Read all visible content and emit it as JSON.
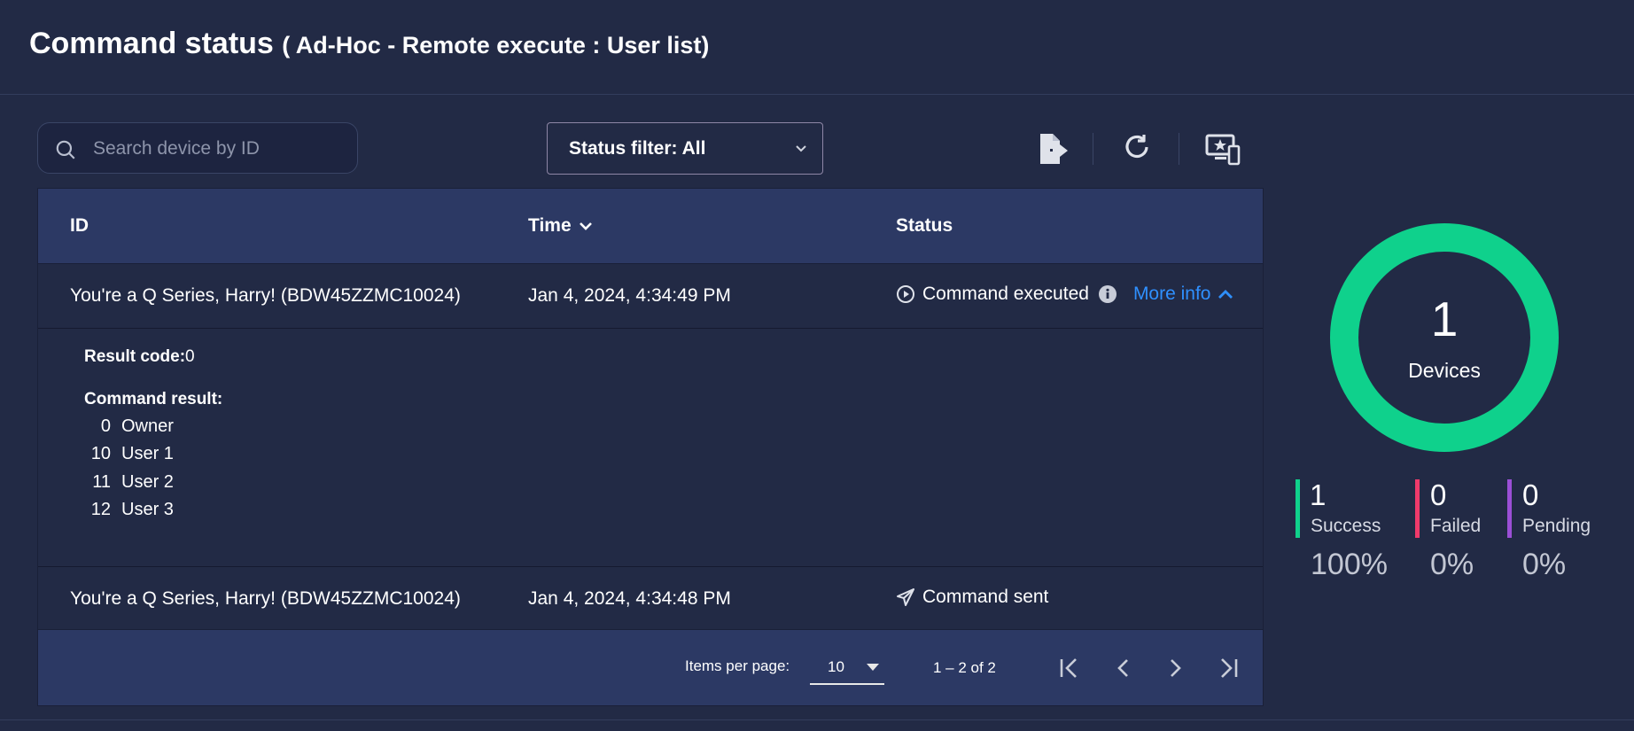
{
  "header": {
    "title": "Command status",
    "subtitle": "( Ad-Hoc - Remote execute : User list)"
  },
  "search": {
    "placeholder": "Search device by ID",
    "value": ""
  },
  "filter": {
    "label": "Status filter: All"
  },
  "toolbar": {
    "icons": [
      "export-icon",
      "refresh-icon",
      "device-star-icon"
    ]
  },
  "table": {
    "columns": {
      "id": "ID",
      "time": "Time",
      "status": "Status"
    },
    "sort": {
      "column": "Time",
      "direction": "desc"
    },
    "rows": [
      {
        "id": "You're a Q Series, Harry! (BDW45ZZMC10024)",
        "time": "Jan 4, 2024, 4:34:49 PM",
        "status": "Command executed",
        "more_info": "More info",
        "expanded": true,
        "details": {
          "result_code_label": "Result code:",
          "result_code": "0",
          "command_result_label": "Command result:",
          "users": [
            {
              "id": "0",
              "name": "Owner"
            },
            {
              "id": "10",
              "name": "User 1"
            },
            {
              "id": "11",
              "name": "User 2"
            },
            {
              "id": "12",
              "name": "User 3"
            }
          ]
        }
      },
      {
        "id": "You're a Q Series, Harry! (BDW45ZZMC10024)",
        "time": "Jan 4, 2024, 4:34:48 PM",
        "status": "Command sent"
      }
    ]
  },
  "pagination": {
    "items_per_page_label": "Items per page:",
    "items_per_page": "10",
    "range": "1 – 2 of 2"
  },
  "summary": {
    "total": "1",
    "total_label": "Devices",
    "success": {
      "count": "1",
      "label": "Success",
      "percent": "100%",
      "color": "#0fd18c"
    },
    "failed": {
      "count": "0",
      "label": "Failed",
      "percent": "0%",
      "color": "#ef3a6b"
    },
    "pending": {
      "count": "0",
      "label": "Pending",
      "percent": "0%",
      "color": "#9b4fd6"
    }
  },
  "colors": {
    "background": "#222a45",
    "table_header": "#2c3964",
    "link": "#2f90ff"
  }
}
